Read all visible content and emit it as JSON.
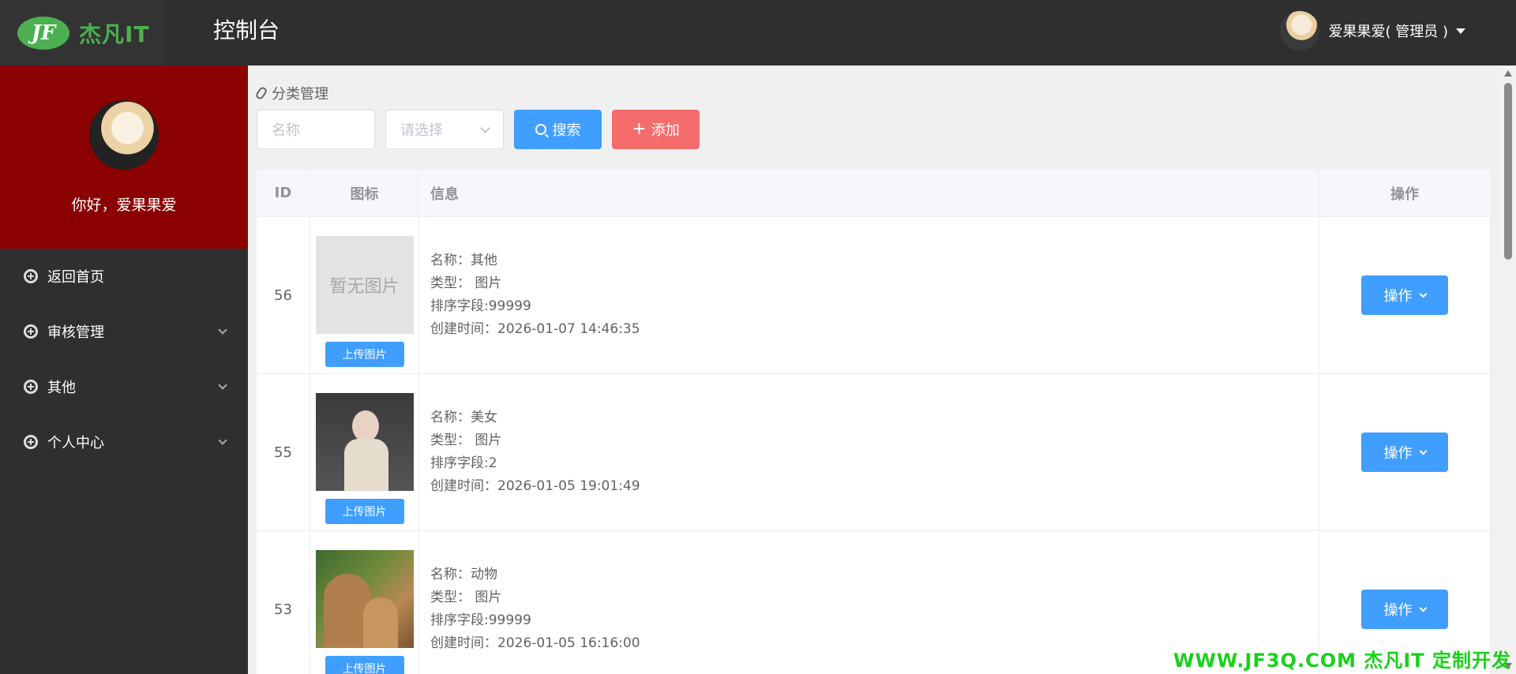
{
  "header": {
    "logo_text": "杰凡IT",
    "logo_mark": "JF",
    "page_title": "控制台",
    "user_label": "爱果果爱( 管理员 )"
  },
  "sidebar": {
    "greeting": "你好，爱果果爱",
    "items": [
      {
        "label": "返回首页",
        "has_submenu": false
      },
      {
        "label": "审核管理",
        "has_submenu": true
      },
      {
        "label": "其他",
        "has_submenu": true
      },
      {
        "label": "个人中心",
        "has_submenu": true
      }
    ]
  },
  "main": {
    "section_title": "分类管理",
    "name_placeholder": "名称",
    "select_placeholder": "请选择",
    "search_label": "搜索",
    "add_label": "添加"
  },
  "table": {
    "headers": {
      "id": "ID",
      "icon": "图标",
      "info": "信息",
      "op": "操作"
    },
    "upload_label": "上传图片",
    "op_label": "操作",
    "empty_image_text": "暂无图片",
    "rows": [
      {
        "id": "56",
        "image": "empty",
        "name": "名称：其他",
        "type": "类型：  图片",
        "sort": "排序字段:99999",
        "created": "创建时间：2026-01-07 14:46:35"
      },
      {
        "id": "55",
        "image": "woman-photo",
        "name": "名称：美女",
        "type": "类型：  图片",
        "sort": "排序字段:2",
        "created": "创建时间：2026-01-05 19:01:49"
      },
      {
        "id": "53",
        "image": "kangaroo-photo",
        "name": "名称：动物",
        "type": "类型：  图片",
        "sort": "排序字段:99999",
        "created": "创建时间：2026-01-05 16:16:00"
      }
    ]
  },
  "watermark": "WWW.JF3Q.COM 杰凡IT  定制开发",
  "colors": {
    "primary": "#409eff",
    "danger": "#f56c6c",
    "profile_bg": "#8b0000",
    "dark": "#2f2f2f",
    "brand_green": "#4caf50"
  }
}
